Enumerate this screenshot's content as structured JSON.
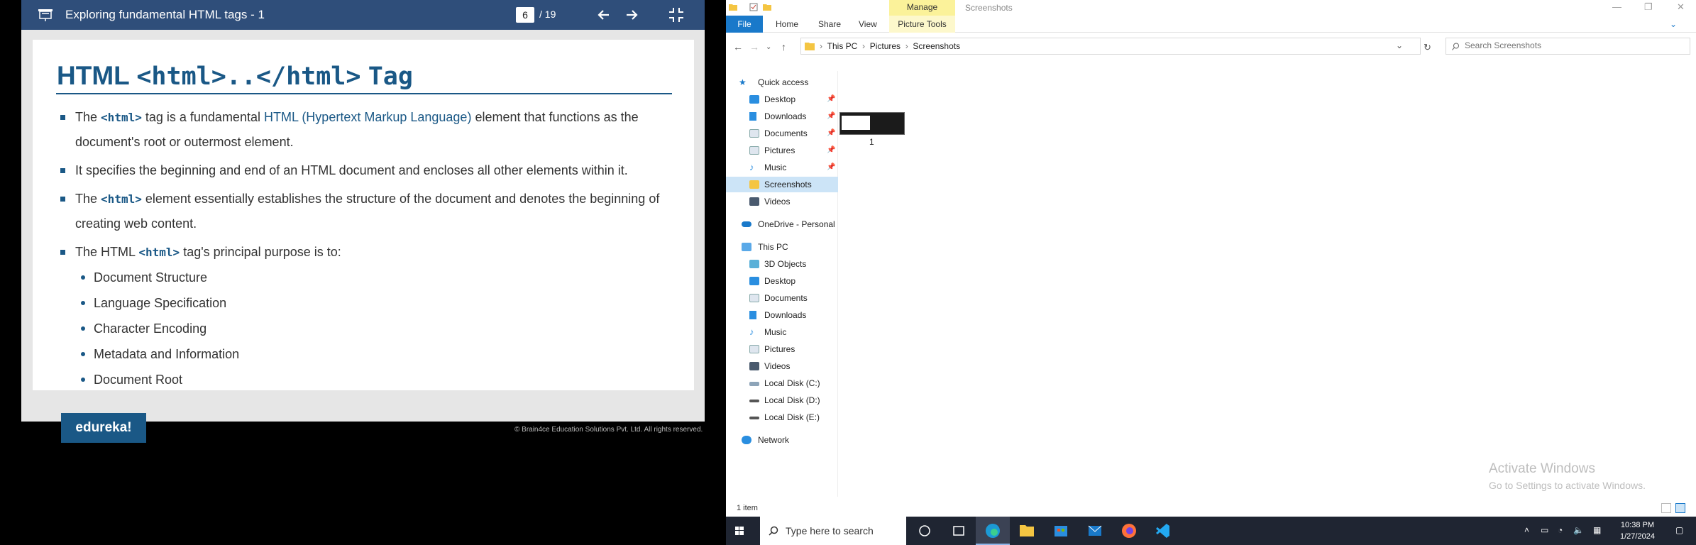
{
  "viewer": {
    "title": "Exploring fundamental HTML tags - 1",
    "page_current": "6",
    "page_total": "/ 19"
  },
  "slide": {
    "title_prefix": "HTML",
    "title_code": "<html>..</html>",
    "title_suffix": "Tag",
    "bullets": [
      {
        "pre": "The",
        "code": "<html>",
        "mid": "tag is a fundamental",
        "link": "HTML (Hypertext Markup Language)",
        "post": "element that functions as the document's root or outermost element."
      },
      {
        "text": "It specifies the beginning and end of an HTML document and encloses all other elements within it."
      },
      {
        "pre": "The",
        "code": "<html>",
        "post": "element essentially establishes the structure of the document and denotes the beginning of creating web content."
      },
      {
        "pre": "The HTML",
        "code": "<html>",
        "post": "tag's principal purpose is to:"
      }
    ],
    "subbullets": [
      "Document Structure",
      "Language Specification",
      "Character Encoding",
      "Metadata and Information",
      "Document Root"
    ],
    "footer_logo": "edureka!",
    "footer_copy": "© Brain4ce Education Solutions Pvt. Ltd. All rights reserved."
  },
  "explorer": {
    "manage_label": "Manage",
    "window_title": "Screenshots",
    "ribbon": {
      "file": "File",
      "home": "Home",
      "share": "Share",
      "view": "View",
      "picture_tools": "Picture Tools"
    },
    "breadcrumb": [
      "This PC",
      "Pictures",
      "Screenshots"
    ],
    "search_placeholder": "Search Screenshots",
    "nav": {
      "quick_access": "Quick access",
      "quick_items": [
        "Desktop",
        "Downloads",
        "Documents",
        "Pictures",
        "Music",
        "Screenshots",
        "Videos"
      ],
      "onedrive": "OneDrive - Personal",
      "this_pc": "This PC",
      "pc_items": [
        "3D Objects",
        "Desktop",
        "Documents",
        "Downloads",
        "Music",
        "Pictures",
        "Videos",
        "Local Disk (C:)",
        "Local Disk (D:)",
        "Local Disk (E:)"
      ],
      "network": "Network"
    },
    "file_item": "1",
    "status": "1 item",
    "activate_title": "Activate Windows",
    "activate_sub": "Go to Settings to activate Windows."
  },
  "taskbar": {
    "search_text": "Type here to search",
    "time": "10:38 PM",
    "date": "1/27/2024"
  },
  "colors": {
    "accent": "#1a5886",
    "viewer_bar": "#2f4e7a",
    "file_tab": "#1979ca",
    "taskbar": "#1f2532"
  }
}
